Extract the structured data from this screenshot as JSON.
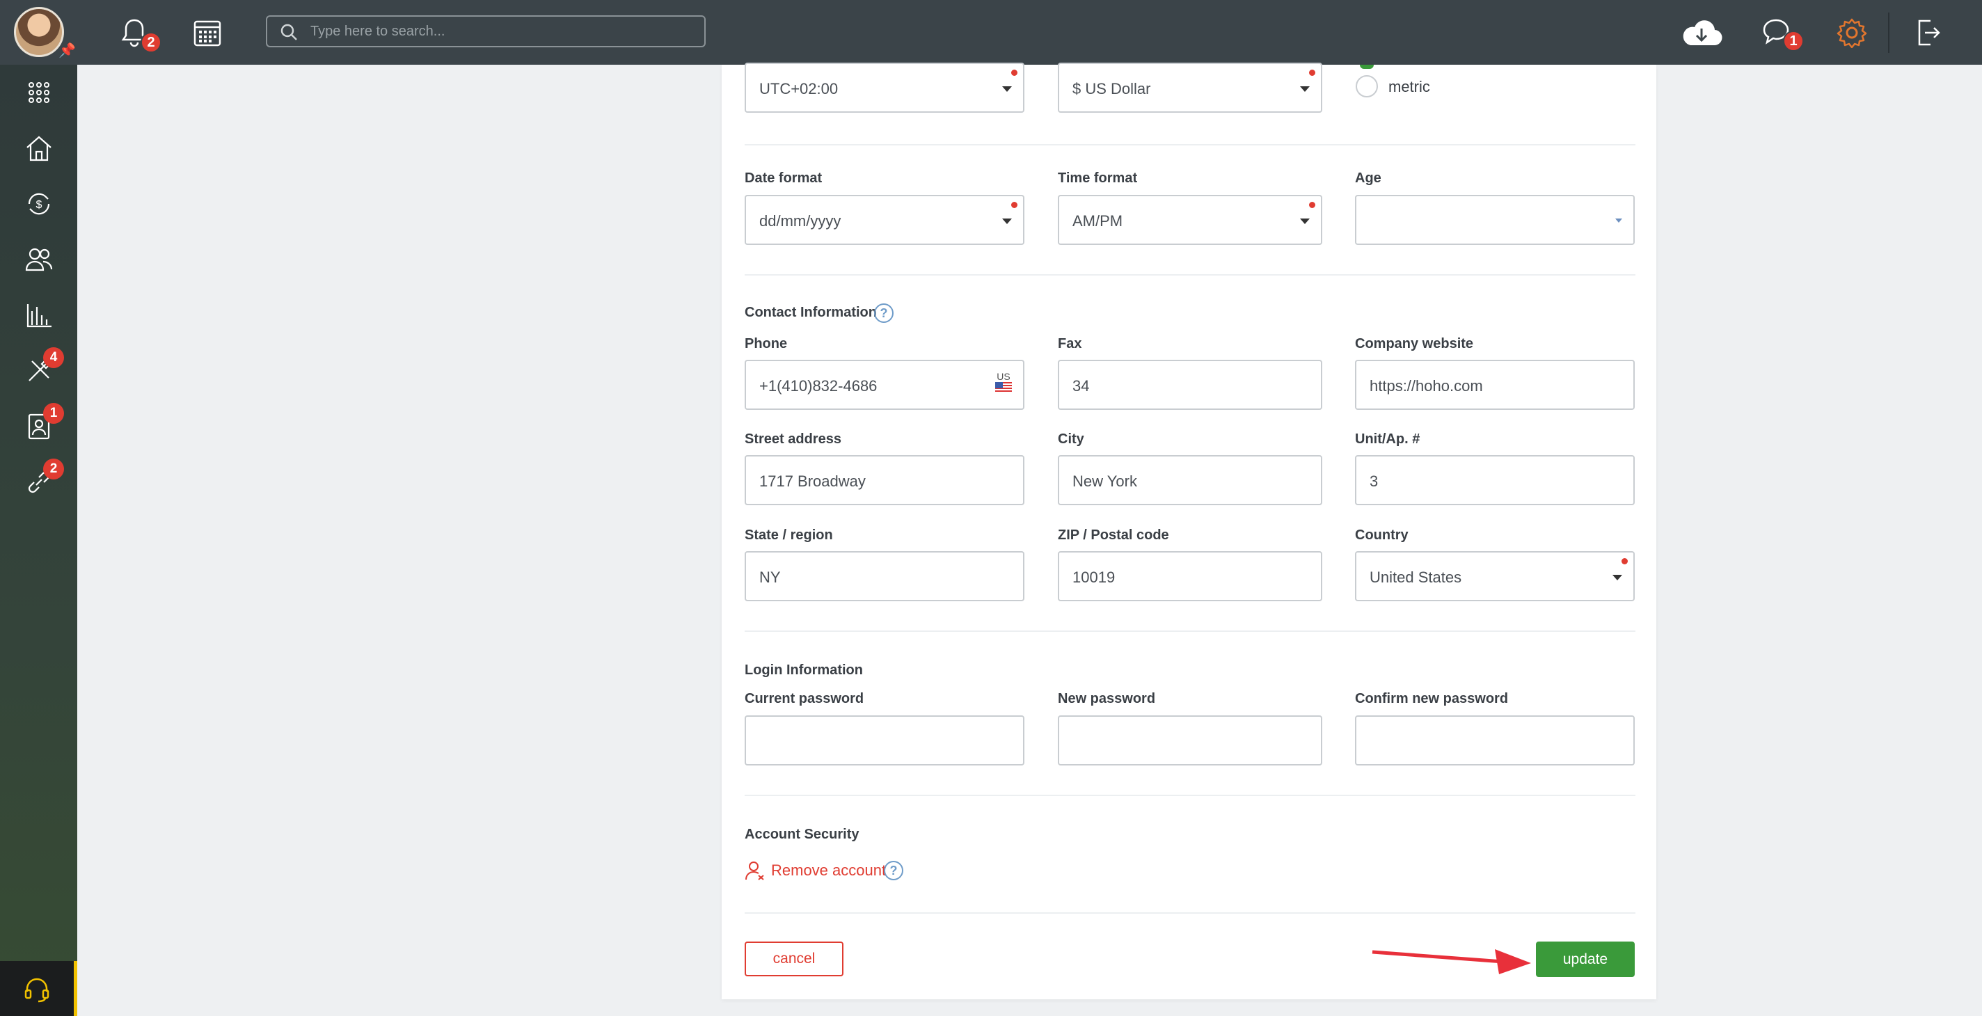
{
  "topbar": {
    "search_placeholder": "Type here to search...",
    "notifications_badge": "2",
    "chat_badge": "1"
  },
  "sidebar": {
    "badges": {
      "tools": "4",
      "contacts": "1",
      "integrations": "2"
    }
  },
  "form": {
    "timezone": {
      "value": "UTC+02:00"
    },
    "currency": {
      "value": "$ US Dollar"
    },
    "units": {
      "metric_label": "metric"
    },
    "date_format": {
      "label": "Date format",
      "value": "dd/mm/yyyy"
    },
    "time_format": {
      "label": "Time format",
      "value": "AM/PM"
    },
    "age": {
      "label": "Age",
      "value": ""
    },
    "contact": {
      "title": "Contact Information",
      "phone": {
        "label": "Phone",
        "value": "+1(410)832-4686",
        "country_code": "US"
      },
      "fax": {
        "label": "Fax",
        "value": "34"
      },
      "website": {
        "label": "Company website",
        "value": "https://hoho.com"
      },
      "street": {
        "label": "Street address",
        "value": "1717 Broadway"
      },
      "city": {
        "label": "City",
        "value": "New York"
      },
      "unit": {
        "label": "Unit/Ap. #",
        "value": "3"
      },
      "state": {
        "label": "State / region",
        "value": "NY"
      },
      "zip": {
        "label": "ZIP / Postal code",
        "value": "10019"
      },
      "country": {
        "label": "Country",
        "value": "United States"
      }
    },
    "login": {
      "title": "Login Information",
      "current_password": {
        "label": "Current password",
        "value": ""
      },
      "new_password": {
        "label": "New password",
        "value": ""
      },
      "confirm_password": {
        "label": "Confirm new password",
        "value": ""
      }
    },
    "security": {
      "title": "Account Security",
      "remove_label": "Remove account"
    },
    "actions": {
      "cancel": "cancel",
      "update": "update"
    }
  },
  "colors": {
    "topbar": "#3b4449",
    "accent_red": "#e03c31",
    "update_green": "#3a9a3a",
    "arrow": "#e8303a"
  }
}
